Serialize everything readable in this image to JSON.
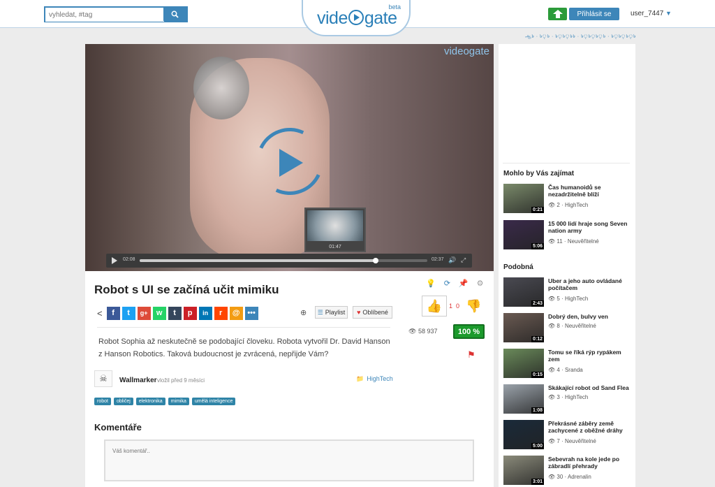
{
  "header": {
    "search_placeholder": "vyhledat, #tag",
    "logo_prefix": "vide",
    "logo_suffix": "gate",
    "logo_beta": "beta",
    "login_label": "Přihlásit se",
    "username": "user_7447",
    "lang_links": "ஆ৳ · ৳ৃ৳ · ৳ৃ৳ৃ৳৳ · ৳ৃ৳ৃ৳ৃ৳ · ৳ৃ৳ৃ৳ৃ৳"
  },
  "video": {
    "watermark": "videogate",
    "current_time": "02:08",
    "duration": "02:37",
    "preview_time": "01:47",
    "progress": 0.82
  },
  "details": {
    "title": "Robot s UI se začíná učit mimiku",
    "playlist_label": "Playlist",
    "favorite_label": "Oblíbené",
    "likes": "1",
    "dislikes": "0",
    "views": "58 937",
    "rating": "100 %",
    "description": "Robot Sophia až neskutečně se podobající človeku. Robota vytvořil Dr. David Hanson z Hanson Robotics. Taková budoucnost je zvrácená, nepřijde Vám?",
    "author": "Wallmarker",
    "author_meta": "vložil před 9 měsíci",
    "category": "HighTech",
    "tags": [
      "robot",
      "obličej",
      "elektronika",
      "mimika",
      "umělá inteligence"
    ]
  },
  "comments": {
    "heading": "Komentáře",
    "placeholder": "Váš komentář.."
  },
  "sidebar": {
    "section_maybe": "Mohlo by Vás zajímat",
    "maybe_items": [
      {
        "title": "Čas humanoidů se nezadržitelně blíží",
        "views": "2",
        "category": "HighTech",
        "duration": "0:21",
        "color": "#7a8a6a"
      },
      {
        "title": "15 000 lidí hraje song Seven nation army",
        "views": "11",
        "category": "Neuvěřitelné",
        "duration": "5:06",
        "color": "#3a2a4a"
      }
    ],
    "section_similar": "Podobná",
    "similar_items": [
      {
        "title": "Uber a jeho auto ovládané počítačem",
        "views": "5",
        "category": "HighTech",
        "duration": "2:43",
        "color": "#4a4a52"
      },
      {
        "title": "Dobrý den, bulvy ven",
        "views": "8",
        "category": "Neuvěřitelné",
        "duration": "0:12",
        "color": "#6a5a52"
      },
      {
        "title": "Tomu se říká rýp rypákem zem",
        "views": "4",
        "category": "Sranda",
        "duration": "0:15",
        "color": "#6a8a5a"
      },
      {
        "title": "Skákající robot od Sand Flea",
        "views": "3",
        "category": "HighTech",
        "duration": "1:08",
        "color": "#9aa2aa"
      },
      {
        "title": "Překrásné záběry země zachycené z oběžné dráhy",
        "views": "7",
        "category": "Neuvěřitelné",
        "duration": "5:00",
        "color": "#1a2a3a"
      },
      {
        "title": "Sebevrah na kole jede po zábradlí přehrady",
        "views": "30",
        "category": "Adrenalin",
        "duration": "3:01",
        "color": "#8a8a7a"
      }
    ]
  },
  "colors": {
    "accent": "#3d86b9",
    "green": "#1c9a2c",
    "red": "#d33333"
  }
}
